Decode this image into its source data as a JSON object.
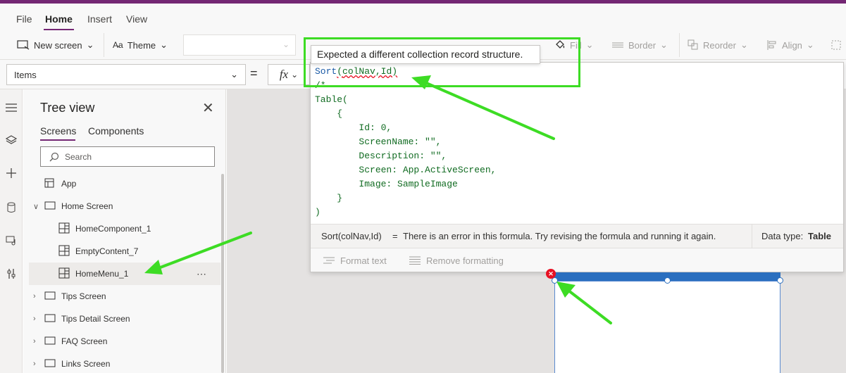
{
  "menu": {
    "items": [
      "File",
      "Home",
      "Insert",
      "View"
    ],
    "active": "Home"
  },
  "ribbon": {
    "new_screen": "New screen",
    "theme": "Theme",
    "fill": "Fill",
    "border": "Border",
    "reorder": "Reorder",
    "align": "Align"
  },
  "formula_bar": {
    "property": "Items",
    "equals": "=",
    "fx": "fx"
  },
  "tooltip": {
    "text": "Expected a different collection record structure."
  },
  "editor": {
    "fn_name": "Sort",
    "fn_args": "colNav,Id",
    "code_lines": [
      "/*",
      "Table(",
      "    {",
      "        Id: 0,",
      "        ScreenName: \"\",",
      "        Description: \"\",",
      "        Screen: App.ActiveScreen,",
      "        Image: SampleImage",
      "    }",
      ")"
    ]
  },
  "error_bar": {
    "formula": "Sort(colNav,Id)",
    "equals": "=",
    "message": "There is an error in this formula. Try revising the formula and running it again.",
    "data_type_label": "Data type:",
    "data_type_value": "Table"
  },
  "format_bar": {
    "format_text": "Format text",
    "remove_formatting": "Remove formatting"
  },
  "tree": {
    "title": "Tree view",
    "tabs": [
      "Screens",
      "Components"
    ],
    "active_tab": "Screens",
    "search_placeholder": "Search",
    "items": [
      {
        "label": "App",
        "level": 0,
        "icon": "app-icon",
        "expand": "none"
      },
      {
        "label": "Home Screen",
        "level": 0,
        "icon": "screen-icon",
        "expand": "expanded"
      },
      {
        "label": "HomeComponent_1",
        "level": 1,
        "icon": "component-icon",
        "expand": "none"
      },
      {
        "label": "EmptyContent_7",
        "level": 1,
        "icon": "component-icon",
        "expand": "none"
      },
      {
        "label": "HomeMenu_1",
        "level": 1,
        "icon": "component-icon",
        "expand": "none",
        "selected": true
      },
      {
        "label": "Tips Screen",
        "level": 0,
        "icon": "screen-icon",
        "expand": "collapsed"
      },
      {
        "label": "Tips Detail Screen",
        "level": 0,
        "icon": "screen-icon",
        "expand": "collapsed"
      },
      {
        "label": "FAQ Screen",
        "level": 0,
        "icon": "screen-icon",
        "expand": "collapsed"
      },
      {
        "label": "Links Screen",
        "level": 0,
        "icon": "screen-icon",
        "expand": "collapsed"
      }
    ]
  },
  "colors": {
    "brand": "#742774",
    "annotation": "#3ddc24",
    "error": "#e81123",
    "selection": "#2b6fbf"
  }
}
